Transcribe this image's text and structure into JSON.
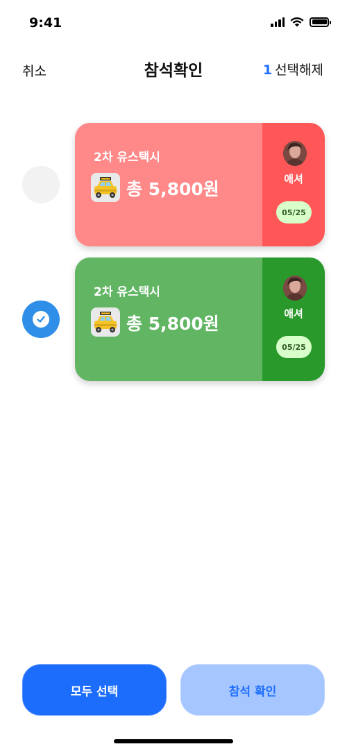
{
  "status_bar": {
    "time": "9:41",
    "icons": [
      "signal-icon",
      "wifi-icon",
      "battery-icon"
    ]
  },
  "header": {
    "cancel_label": "취소",
    "title": "참석확인",
    "selected_count": "1",
    "deselect_label": "선택해제"
  },
  "cards": [
    {
      "title": "2차 유스택시",
      "icon": "taxi-icon",
      "amount": "총 5,800원",
      "host": "애셔",
      "date": "05/25",
      "selected": false,
      "main_color": "#ff8888",
      "side_color": "#ff5757"
    },
    {
      "title": "2차 유스택시",
      "icon": "taxi-icon",
      "amount": "총 5,800원",
      "host": "애셔",
      "date": "05/25",
      "selected": true,
      "main_color": "#61b563",
      "side_color": "#28992a"
    }
  ],
  "footer": {
    "select_all_label": "모두 선택",
    "confirm_label": "참석 확인"
  },
  "colors": {
    "accent": "#1c6dfc",
    "check_blue": "#2f8fe8",
    "date_badge_bg": "#d8ffc9"
  }
}
